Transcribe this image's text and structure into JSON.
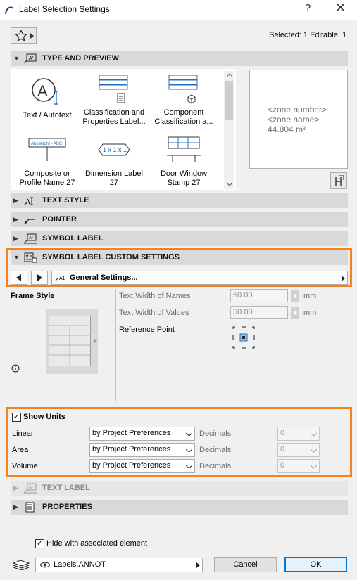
{
  "window": {
    "title": "Label Selection Settings",
    "help": "?",
    "close": "✕"
  },
  "toolbar": {
    "favorites_icon": "star-icon",
    "selection_info": "Selected: 1 Editable: 1"
  },
  "panels": {
    "type_preview": "TYPE AND PREVIEW",
    "text_style": "TEXT STYLE",
    "pointer": "POINTER",
    "symbol_label": "SYMBOL LABEL",
    "custom_settings": "SYMBOL LABEL CUSTOM SETTINGS",
    "text_label": "TEXT LABEL",
    "properties": "PROPERTIES"
  },
  "library": {
    "items": [
      {
        "l1": "Text / Autotext",
        "l2": ""
      },
      {
        "l1": "Classification and",
        "l2": "Properties Label..."
      },
      {
        "l1": "Component",
        "l2": "Classification a..."
      },
      {
        "l1": "Composite or",
        "l2": "Profile Name 27"
      },
      {
        "l1": "Dimension Label",
        "l2": "27"
      },
      {
        "l1": "Door Window",
        "l2": "Stamp 27"
      }
    ],
    "thumb_sample": "Abcdefghi - ABC",
    "thumb_dim": "1 x 1 x 1"
  },
  "preview": {
    "line1": "<zone number>",
    "line2": "<zone name>",
    "line3": "44.804 m²"
  },
  "custom": {
    "page": "General Settings..."
  },
  "frame": {
    "title": "Frame Style",
    "text_width_names": "Text Width of Names",
    "names_value": "50.00",
    "text_width_values": "Text Width of Values",
    "values_value": "50.00",
    "unit": "mm",
    "reference_point": "Reference Point"
  },
  "units": {
    "show_label": "Show Units",
    "show_checked": true,
    "rows": [
      {
        "name": "Linear",
        "pref": "by Project Preferences",
        "dec_label": "Decimals",
        "dec": "0"
      },
      {
        "name": "Area",
        "pref": "by Project Preferences",
        "dec_label": "Decimals",
        "dec": "0"
      },
      {
        "name": "Volume",
        "pref": "by Project Preferences",
        "dec_label": "Decimals",
        "dec": "0"
      }
    ]
  },
  "footer": {
    "hide_label": "Hide with associated element",
    "layer": "Labels.ANNOT",
    "cancel": "Cancel",
    "ok": "OK"
  },
  "colors": {
    "accent_orange": "#f6821f",
    "ok_border": "#0078d7"
  }
}
